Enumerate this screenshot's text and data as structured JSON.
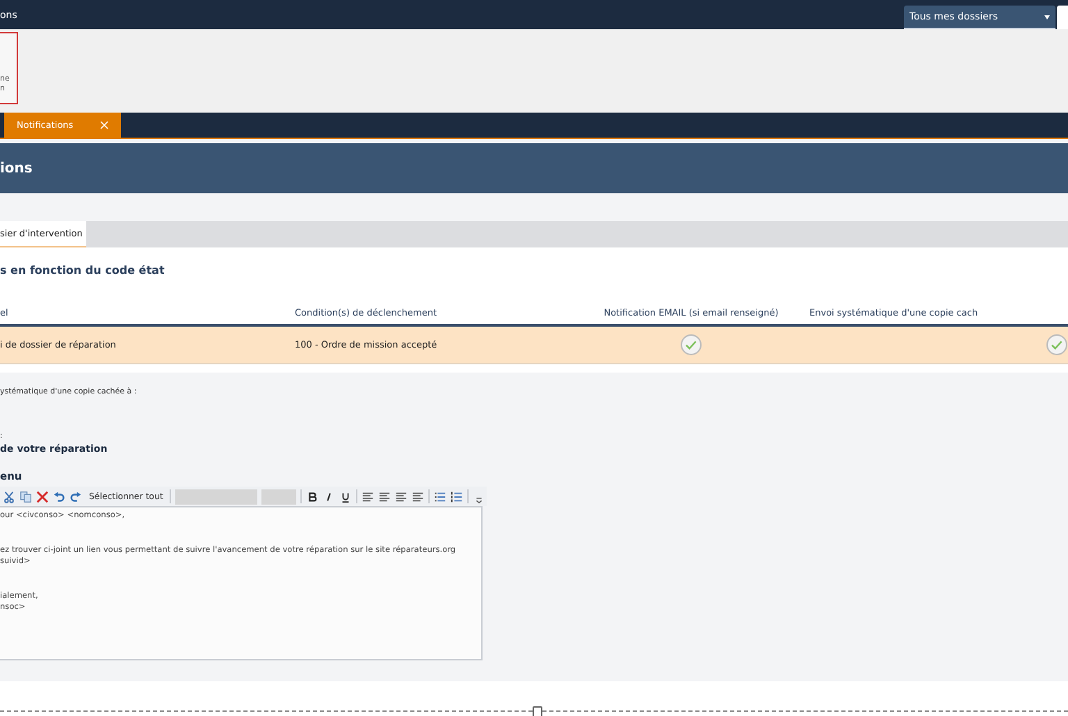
{
  "top_bar": {
    "title": "ons",
    "folder_select": {
      "value": "Tous mes dossiers"
    }
  },
  "alert_card": {
    "lines": [
      "ne",
      "n"
    ]
  },
  "tabs": [
    {
      "label": "Notifications",
      "selected": true
    }
  ],
  "page_header": {
    "title": "ions"
  },
  "sub_tabs": [
    {
      "label": "sier d'intervention",
      "selected": true
    }
  ],
  "section": {
    "title": "s en fonction du code état",
    "table": {
      "columns": [
        "el",
        "Condition(s) de déclenchement",
        "Notification EMAIL (si email renseigné)",
        "Envoi systématique d'une copie cach"
      ],
      "rows": [
        {
          "selected": true,
          "label": "i de dossier de réparation",
          "condition": "100 - Ordre de mission accepté",
          "email": {
            "checked": true
          },
          "bcc": {
            "checked": true
          }
        }
      ]
    }
  },
  "details": {
    "bcc_label": "ystématique d'une copie cachée à :",
    "subject_label": ":",
    "subject": "de votre réparation",
    "content_label": "enu",
    "toolbar": {
      "select_all": "Sélectionner tout"
    },
    "editor_paragraphs": [
      [
        "our <civconso> <nomconso>,"
      ],
      [
        "ez trouver ci-joint un lien vous permettant de suivre l'avancement de votre réparation sur le site réparateurs.org",
        "suivid>"
      ],
      [
        "ialement,",
        "nsoc>"
      ]
    ]
  }
}
